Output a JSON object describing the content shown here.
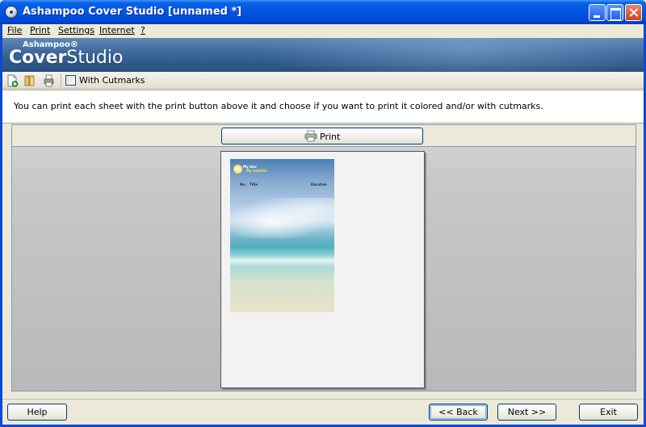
{
  "window": {
    "title": "Ashampoo Cover Studio [unnamed *]"
  },
  "menu": {
    "items": [
      "File",
      "Print",
      "Settings",
      "Internet",
      "?"
    ]
  },
  "banner": {
    "logo_top": "Ashampoo®",
    "logo_prefix": "Cover",
    "logo_suffix": "Studio"
  },
  "toolbar": {
    "cutmarks_label": "With Cutmarks",
    "cutmarks_checked": false,
    "icons": [
      "new-document-icon",
      "open-folder-icon",
      "print-preview-icon"
    ]
  },
  "info": {
    "text": "You can print each sheet with the print button above it and choose if you want to print it colored and/or with cutmarks."
  },
  "preview": {
    "print_label": "Print",
    "cover": {
      "title": "My disc",
      "subtitle": "My subtitle",
      "col_no": "No.",
      "col_title": "Title",
      "col_duration": "Duration"
    }
  },
  "buttons": {
    "help": "Help",
    "back": "<< Back",
    "next": "Next >>",
    "exit": "Exit"
  },
  "colors": {
    "titlebar": "#0055e5",
    "banner": "#3c6797",
    "window_bg": "#ece9d8"
  }
}
